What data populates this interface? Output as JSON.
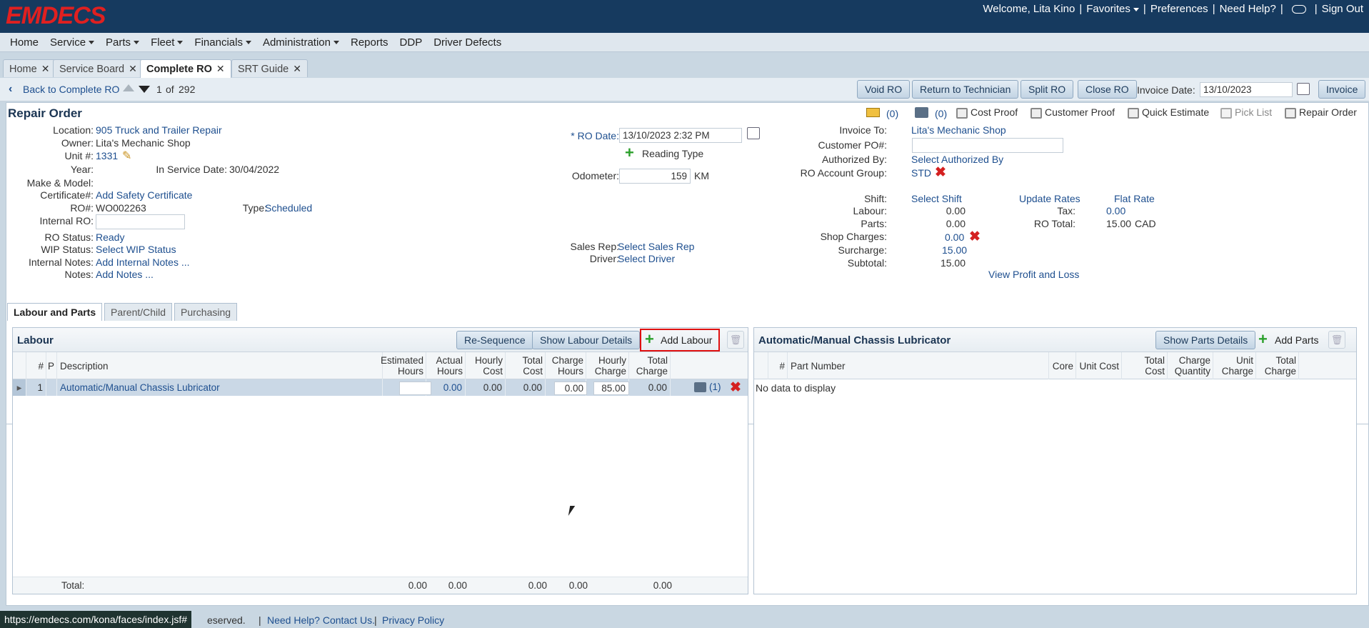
{
  "header": {
    "logo": "EMDECS",
    "welcome": "Welcome, Lita Kino",
    "favorites": "Favorites",
    "preferences": "Preferences",
    "help": "Need Help?",
    "sign_out": "Sign Out"
  },
  "nav": [
    "Home",
    "Service",
    "Parts",
    "Fleet",
    "Financials",
    "Administration",
    "Reports",
    "DDP",
    "Driver Defects"
  ],
  "tabs": [
    "Home",
    "Service Board",
    "Complete RO",
    "SRT Guide"
  ],
  "toolbar": {
    "back": "Back to Complete RO",
    "page_current": "1",
    "page_of": "of",
    "page_total": "292",
    "void": "Void RO",
    "return_tech": "Return to Technician",
    "split": "Split RO",
    "close": "Close RO",
    "invoice_date_label": "Invoice Date:",
    "invoice_date": "13/10/2023",
    "invoice": "Invoice"
  },
  "ro": {
    "title": "Repair Order",
    "location_label": "Location:",
    "location": "905 Truck and Trailer Repair",
    "owner_label": "Owner:",
    "owner": "Lita's Mechanic Shop",
    "unit_label": "Unit #:",
    "unit": "1331",
    "year_label": "Year:",
    "in_service_label": "In Service Date:",
    "in_service": "30/04/2022",
    "make_label": "Make & Model:",
    "cert_label": "Certificate#:",
    "cert": "Add Safety Certificate",
    "ro_label": "RO#:",
    "ro": "WO002263",
    "type_label": "Type:",
    "type": "Scheduled",
    "internal_ro_label": "Internal RO:",
    "status_label": "RO Status:",
    "status": "Ready",
    "wip_label": "WIP Status:",
    "wip": "Select WIP Status",
    "internal_notes_label": "Internal Notes:",
    "internal_notes": "Add Internal Notes ...",
    "notes_label": "Notes:",
    "notes": "Add Notes ...",
    "ro_date_label": "* RO Date:",
    "ro_date": "13/10/2023 2:32 PM",
    "reading_type": "Reading Type",
    "odometer_label": "Odometer:",
    "odometer": "159",
    "odometer_unit": "KM",
    "sales_rep_label": "Sales Rep:",
    "sales_rep": "Select Sales Rep",
    "driver_label": "Driver:",
    "driver": "Select Driver"
  },
  "actions": {
    "email_count": "(0)",
    "camera_count": "(0)",
    "cost_proof": "Cost Proof",
    "customer_proof": "Customer Proof",
    "quick_estimate": "Quick Estimate",
    "pick_list": "Pick List",
    "repair_order": "Repair Order"
  },
  "invoice": {
    "invoice_to_label": "Invoice To:",
    "invoice_to": "Lita's Mechanic Shop",
    "po_label": "Customer PO#:",
    "authorized_label": "Authorized By:",
    "authorized": "Select Authorized By",
    "account_group_label": "RO Account Group:",
    "account_group": "STD",
    "shift_label": "Shift:",
    "shift": "Select Shift",
    "update_rates": "Update Rates",
    "flat_rate": "Flat Rate",
    "labour_label": "Labour:",
    "labour": "0.00",
    "tax_label": "Tax:",
    "tax": "0.00",
    "parts_label": "Parts:",
    "parts": "0.00",
    "ro_total_label": "RO Total:",
    "ro_total": "15.00",
    "currency": "CAD",
    "shop_charges_label": "Shop Charges:",
    "shop_charges": "0.00",
    "surcharge_label": "Surcharge:",
    "surcharge": "15.00",
    "subtotal_label": "Subtotal:",
    "subtotal": "15.00",
    "profit_loss": "View Profit and Loss"
  },
  "subtabs": [
    "Labour and Parts",
    "Parent/Child",
    "Purchasing"
  ],
  "labour": {
    "title": "Labour",
    "resequence": "Re-Sequence",
    "show_details": "Show Labour Details",
    "add": "Add Labour",
    "columns": [
      "#",
      "P",
      "Description",
      "Estimated Hours",
      "Actual Hours",
      "Hourly Cost",
      "Total Cost",
      "Charge Hours",
      "Hourly Charge",
      "Total Charge"
    ],
    "rows": [
      {
        "num": "1",
        "desc": "Automatic/Manual Chassis Lubricator",
        "est": "",
        "actual": "0.00",
        "hcost": "0.00",
        "tcost": "0.00",
        "chours": "0.00",
        "hcharge": "85.00",
        "tcharge": "0.00",
        "camera_count": "(1)"
      }
    ],
    "total_label": "Total:",
    "totals": {
      "est": "0.00",
      "actual": "0.00",
      "tcost": "0.00",
      "chours": "0.00",
      "tcharge": "0.00"
    }
  },
  "parts_panel": {
    "title": "Automatic/Manual Chassis Lubricator",
    "show_details": "Show Parts Details",
    "add": "Add Parts",
    "columns": [
      "#",
      "Part Number",
      "Core",
      "Unit Cost",
      "Total Cost",
      "Charge Quantity",
      "Unit Charge",
      "Total Charge"
    ],
    "empty": "No data to display"
  },
  "footer": {
    "status_url": "https://emdecs.com/kona/faces/index.jsf#",
    "reserved": "eserved.",
    "contact": "Need Help? Contact Us.",
    "privacy": "Privacy Policy"
  }
}
